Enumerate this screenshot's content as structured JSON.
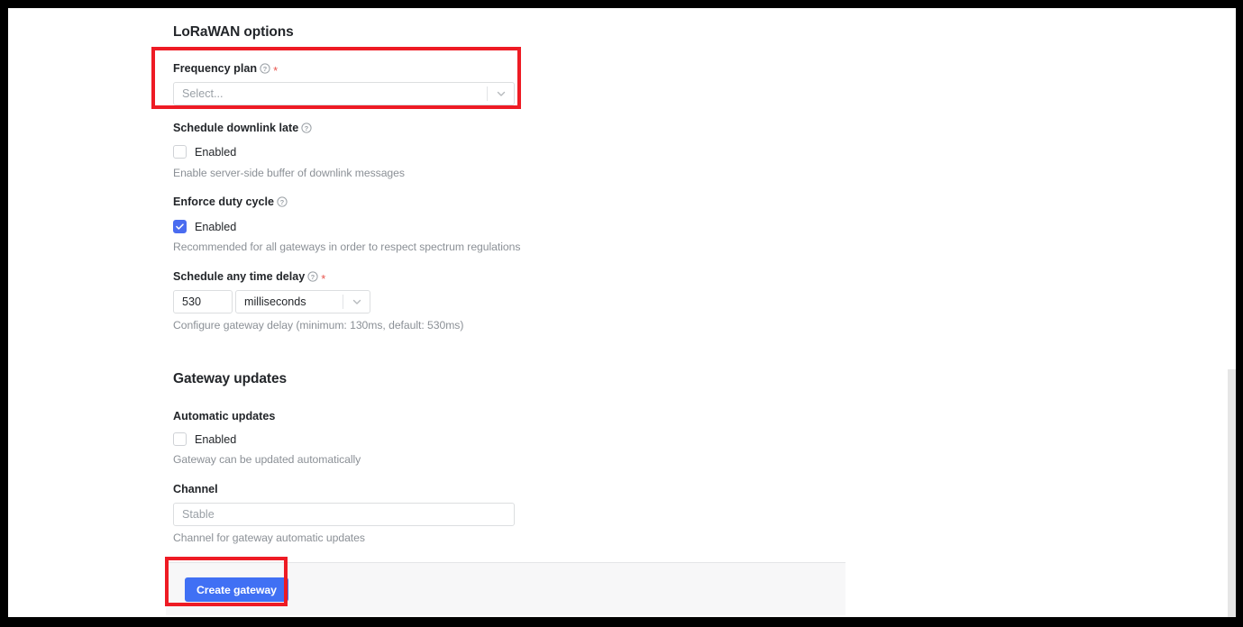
{
  "sections": [
    {
      "title": "LoRaWAN options",
      "fields": [
        {
          "label": "Frequency plan",
          "help_icon": "help-circle-icon",
          "required": true,
          "control": "select",
          "placeholder": "Select...",
          "value": "",
          "description": ""
        },
        {
          "label": "Schedule downlink late",
          "help_icon": "help-circle-icon",
          "required": false,
          "control": "checkbox",
          "checkbox_label": "Enabled",
          "checked": false,
          "description": "Enable server-side buffer of downlink messages"
        },
        {
          "label": "Enforce duty cycle",
          "help_icon": "help-circle-icon",
          "required": false,
          "control": "checkbox",
          "checkbox_label": "Enabled",
          "checked": true,
          "description": "Recommended for all gateways in order to respect spectrum regulations"
        },
        {
          "label": "Schedule any time delay",
          "help_icon": "help-circle-icon",
          "required": true,
          "control": "number-unit",
          "value": "530",
          "unit": "milliseconds",
          "description": "Configure gateway delay (minimum: 130ms, default: 530ms)"
        }
      ]
    },
    {
      "title": "Gateway updates",
      "fields": [
        {
          "label": "Automatic updates",
          "help_icon": "",
          "required": false,
          "control": "checkbox",
          "checkbox_label": "Enabled",
          "checked": false,
          "description": "Gateway can be updated automatically"
        },
        {
          "label": "Channel",
          "help_icon": "",
          "required": false,
          "control": "text",
          "placeholder": "Stable",
          "value": "",
          "description": "Channel for gateway automatic updates"
        }
      ]
    }
  ],
  "footer": {
    "submit_label": "Create gateway"
  },
  "colors": {
    "accent": "#4070f4",
    "checkbox_checked": "#4a6cf0",
    "required_star": "#e8554e",
    "annotation": "#ee1b24",
    "label_text": "#23262a",
    "muted_text": "#8b9096"
  },
  "annotations": [
    {
      "name": "frequency-plan-highlight"
    },
    {
      "name": "create-gateway-highlight"
    }
  ]
}
